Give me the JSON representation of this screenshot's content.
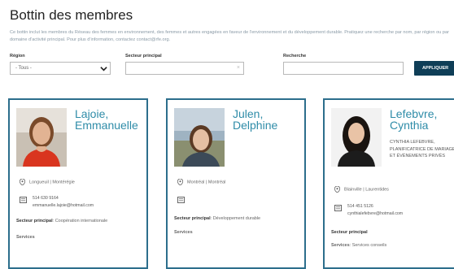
{
  "page": {
    "title": "Bottin des membres",
    "intro": "Ce bottin inclut les membres du Réseau des femmes en environnement, des femmes et autres engagées en faveur de l'environnement et du développement durable. Pratiquez une recherche par nom, par région ou par domaine d'activité principal. Pour plus d'information, contactez contact@rfe.org."
  },
  "filters": {
    "region_label": "Région",
    "region_value": "- Tous -",
    "sector_label": "Secteur principal",
    "search_label": "Recherche",
    "search_placeholder": "",
    "submit_label": "APPLIQUER"
  },
  "members": [
    {
      "name_line1": "Lajoie,",
      "name_line2": "Emmanuelle",
      "role": "",
      "location": "Longueuil | Montérégie",
      "phone": "514 630 9164",
      "email": "emmanuelle.lajoie@hotmail.com",
      "sector_label": "Secteur principal",
      "sector_value": "Coopération internationale",
      "services_label": "Services"
    },
    {
      "name_line1": "Julen,",
      "name_line2": "Delphine",
      "role": "",
      "location": "Montréal | Montréal",
      "phone": "",
      "email": "",
      "sector_label": "Secteur principal",
      "sector_value": "Développement durable",
      "services_label": "Services"
    },
    {
      "name_line1": "Lefebvre,",
      "name_line2": "Cynthia",
      "role": "CYNTHIA LEFEBVRE, PLANIFICATRICE DE MARIAGES ET ÉVÉNEMENTS PRIVÉS",
      "location": "Blainville | Laurentides",
      "phone": "514 451 5126",
      "email": "cynthialefebvre@hotmail.com",
      "sector_label": "Secteur principal",
      "sector_value": "",
      "services_label": "Services",
      "services_value": "Services conseils"
    }
  ]
}
